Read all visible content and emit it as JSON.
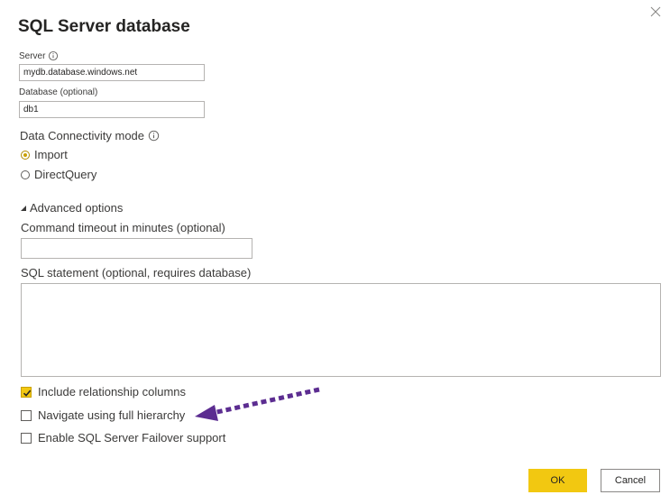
{
  "dialog": {
    "title": "SQL Server database",
    "close_icon": "close-icon"
  },
  "server": {
    "label": "Server",
    "value": "mydb.database.windows.net",
    "info_icon": "info-icon"
  },
  "database": {
    "label": "Database (optional)",
    "value": "db1"
  },
  "connectivity": {
    "label": "Data Connectivity mode",
    "info_icon": "info-icon",
    "options": [
      {
        "label": "Import",
        "selected": true
      },
      {
        "label": "DirectQuery",
        "selected": false
      }
    ]
  },
  "advanced": {
    "toggle_label": "Advanced options",
    "toggle_icon": "triangle-expanded-icon",
    "timeout_label": "Command timeout in minutes (optional)",
    "timeout_value": "",
    "sql_label": "SQL statement (optional, requires database)",
    "sql_value": ""
  },
  "options": [
    {
      "label": "Include relationship columns",
      "checked": true
    },
    {
      "label": "Navigate using full hierarchy",
      "checked": false
    },
    {
      "label": "Enable SQL Server Failover support",
      "checked": false
    }
  ],
  "annotation": {
    "arrow_icon": "dotted-arrow-icon",
    "arrow_color": "#5c2d91"
  },
  "buttons": {
    "ok_label": "OK",
    "cancel_label": "Cancel"
  },
  "colors": {
    "accent": "#f2c811",
    "text": "#252423"
  }
}
